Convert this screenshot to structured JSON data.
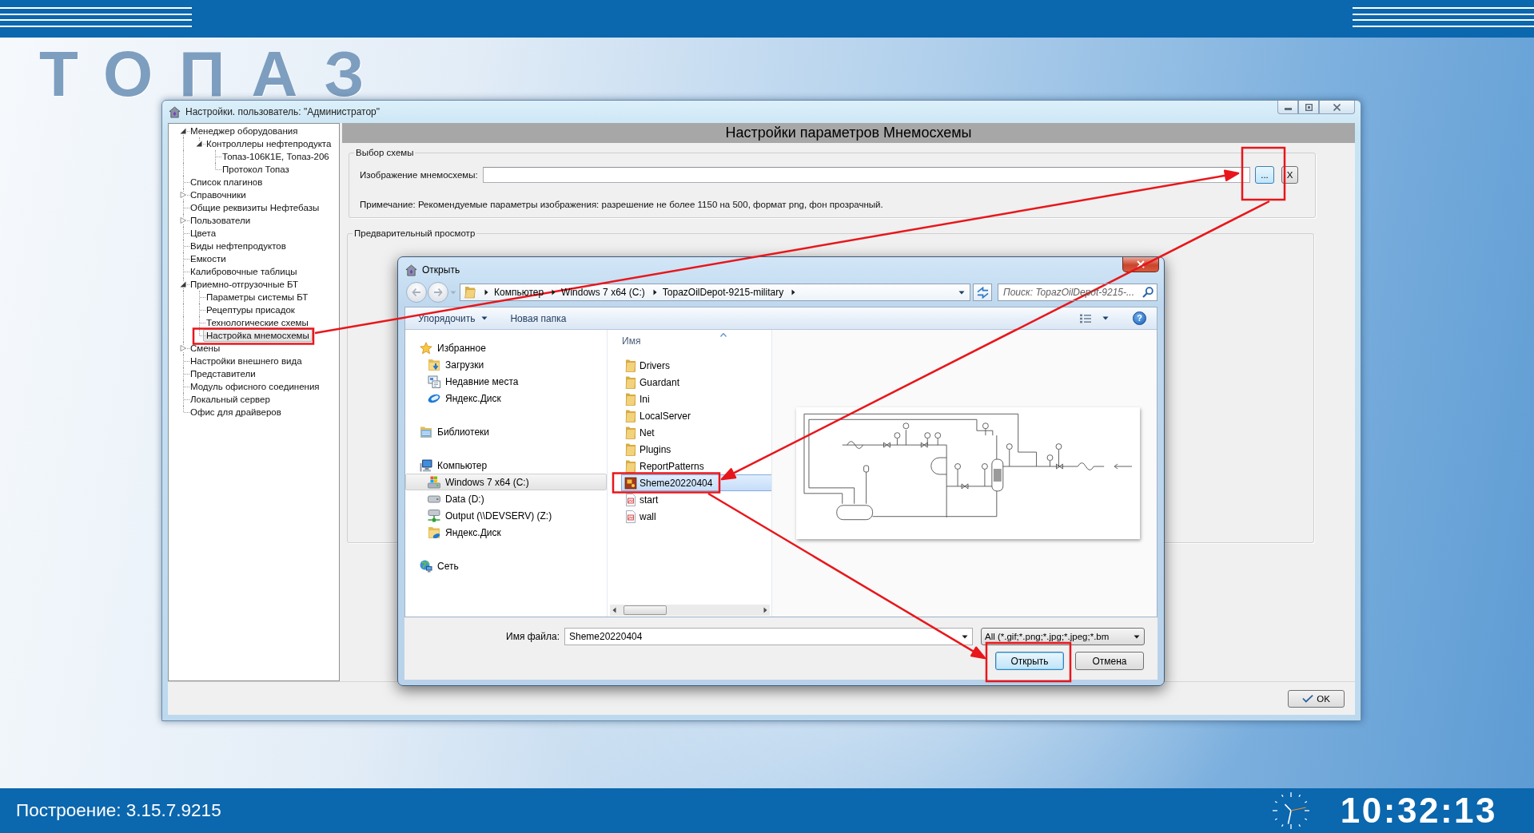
{
  "desktop": {
    "logo": "ТОПАЗ"
  },
  "settings_window": {
    "title": "Настройки. пользователь: \"Администратор\"",
    "tree": [
      {
        "label": "Менеджер оборудования",
        "kind": "branch",
        "expanded": true,
        "selected": false,
        "children": [
          {
            "label": "Контроллеры нефтепродукта",
            "kind": "branch",
            "expanded": true,
            "selected": false,
            "children": [
              {
                "label": "Топаз-106К1Е, Топаз-206",
                "kind": "leaf",
                "selected": false
              },
              {
                "label": "Протокол Топаз",
                "kind": "leaf",
                "selected": false
              }
            ]
          }
        ]
      },
      {
        "label": "Список плагинов",
        "kind": "leaf",
        "selected": false
      },
      {
        "label": "Справочники",
        "kind": "branch",
        "expanded": false,
        "selected": false
      },
      {
        "label": "Общие реквизиты Нефтебазы",
        "kind": "leaf",
        "selected": false
      },
      {
        "label": "Пользователи",
        "kind": "branch",
        "expanded": false,
        "selected": false
      },
      {
        "label": "Цвета",
        "kind": "leaf",
        "selected": false
      },
      {
        "label": "Виды нефтепродуктов",
        "kind": "leaf",
        "selected": false
      },
      {
        "label": "Емкости",
        "kind": "leaf",
        "selected": false
      },
      {
        "label": "Калибровочные таблицы",
        "kind": "leaf",
        "selected": false
      },
      {
        "label": "Приемно-отгрузочные БТ",
        "kind": "branch",
        "expanded": true,
        "selected": false,
        "children": [
          {
            "label": "Параметры системы БТ",
            "kind": "leaf",
            "selected": false
          },
          {
            "label": "Рецептуры присадок",
            "kind": "leaf",
            "selected": false
          },
          {
            "label": "Технологические схемы",
            "kind": "leaf",
            "selected": false
          },
          {
            "label": "Настройка мнемосхемы",
            "kind": "leaf",
            "selected": true
          }
        ]
      },
      {
        "label": "Смены",
        "kind": "branch",
        "expanded": false,
        "selected": false
      },
      {
        "label": "Настройки внешнего вида",
        "kind": "leaf",
        "selected": false
      },
      {
        "label": "Представители",
        "kind": "leaf",
        "selected": false
      },
      {
        "label": "Модуль офисного соединения",
        "kind": "leaf",
        "selected": false
      },
      {
        "label": "Локальный сервер",
        "kind": "leaf",
        "selected": false
      },
      {
        "label": "Офис для драйверов",
        "kind": "leaf",
        "selected": false
      }
    ],
    "panel_title": "Настройки параметров Мнемосхемы",
    "scheme_group": {
      "title": "Выбор схемы",
      "image_label": "Изображение мнемосхемы:",
      "browse_button": "...",
      "clear_button": "X",
      "note": "Примечание: Рекомендуемые параметры изображения: разрешение не более 1150 на 500, формат png, фон прозрачный."
    },
    "preview_group": {
      "title": "Предварительный просмотр"
    },
    "ok_button": "OK"
  },
  "open_dialog": {
    "title": "Открыть",
    "breadcrumb": [
      "Компьютер",
      "Windows 7 x64 (C:)",
      "TopazOilDepot-9215-military"
    ],
    "search": {
      "placeholder": "Поиск: TopazOilDepot-9215-..."
    },
    "toolbar": [
      {
        "label": "Упорядочить",
        "kind": "menu"
      },
      {
        "label": "Новая папка",
        "kind": "button"
      }
    ],
    "help": "?",
    "nav": [
      {
        "label": "Избранное",
        "kind": "favorites",
        "selected": false,
        "children": [
          {
            "label": "Загрузки",
            "kind": "downloads",
            "selected": false
          },
          {
            "label": "Недавние места",
            "kind": "recent",
            "selected": false
          },
          {
            "label": "Яндекс.Диск",
            "kind": "cloud",
            "selected": false
          }
        ]
      },
      {
        "label": "Библиотеки",
        "kind": "libraries",
        "selected": false
      },
      {
        "label": "Компьютер",
        "kind": "computer",
        "selected": false,
        "children": [
          {
            "label": "Windows 7 x64 (C:)",
            "kind": "system-drive",
            "selected": true
          },
          {
            "label": "Data (D:)",
            "kind": "drive",
            "selected": false
          },
          {
            "label": "Output (\\\\DEVSERV) (Z:)",
            "kind": "network-drive",
            "selected": false
          },
          {
            "label": "Яндекс.Диск",
            "kind": "cloud-folder",
            "selected": false
          }
        ]
      },
      {
        "label": "Сеть",
        "kind": "network",
        "selected": false
      }
    ],
    "name_column": {
      "label": "Имя",
      "sorted": true
    },
    "files": [
      {
        "name": "Drivers",
        "kind": "folder",
        "selected": false
      },
      {
        "name": "Guardant",
        "kind": "folder",
        "selected": false
      },
      {
        "name": "Ini",
        "kind": "folder",
        "selected": false
      },
      {
        "name": "LocalServer",
        "kind": "folder",
        "selected": false
      },
      {
        "name": "Net",
        "kind": "folder",
        "selected": false
      },
      {
        "name": "Plugins",
        "kind": "folder",
        "selected": false
      },
      {
        "name": "ReportPatterns",
        "kind": "folder",
        "selected": false
      },
      {
        "name": "Sheme20220404",
        "kind": "image",
        "selected": true
      },
      {
        "name": "start",
        "kind": "bitmap",
        "selected": false
      },
      {
        "name": "wall",
        "kind": "bitmap",
        "selected": false
      }
    ],
    "file_name": {
      "label": "Имя файла:",
      "value": "Sheme20220404"
    },
    "file_type": "All (*.gif;*.png;*.jpg;*.jpeg;*.bm",
    "buttons": [
      {
        "label": "Открыть",
        "default": true
      },
      {
        "label": "Отмена",
        "default": false
      }
    ]
  },
  "status_bar": {
    "build": "Построение: 3.15.7.9215",
    "time": "10:32:13"
  }
}
